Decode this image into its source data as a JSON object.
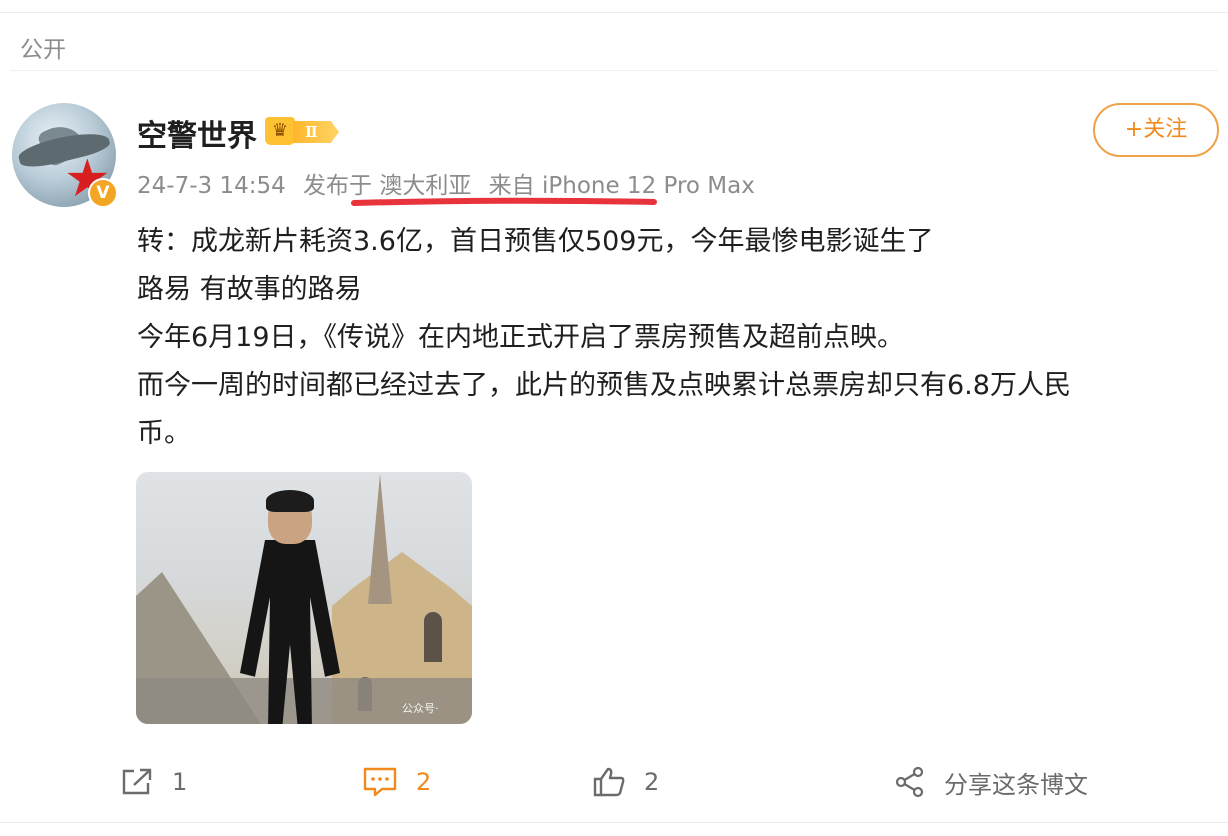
{
  "post": {
    "visibility": "公开",
    "author": {
      "name": "空警世界",
      "level_badge": "Ⅱ",
      "verified_badge": "V"
    },
    "meta": {
      "datetime": "24-7-3 14:54",
      "location": "发布于 澳大利亚",
      "device": "来自 iPhone 12 Pro Max"
    },
    "follow_button": "+关注",
    "content_lines": [
      "转：成龙新片耗资3.6亿，首日预售仅509元，今年最惨电影诞生了",
      "路易  有故事的路易",
      "今年6月19日，《传说》在内地正式开启了票房预售及超前点映。",
      "而今一周的时间都已经过去了，此片的预售及点映累计总票房却只有6.8万人民",
      "币。"
    ],
    "image": {
      "watermark": "公众号·"
    },
    "actions": {
      "repost_count": "1",
      "comment_count": "2",
      "like_count": "2",
      "share_label": "分享这条博文"
    },
    "colors": {
      "accent": "#f08a1f",
      "highlight_underline": "#e8323c",
      "muted_text": "#8c8c8c"
    }
  }
}
